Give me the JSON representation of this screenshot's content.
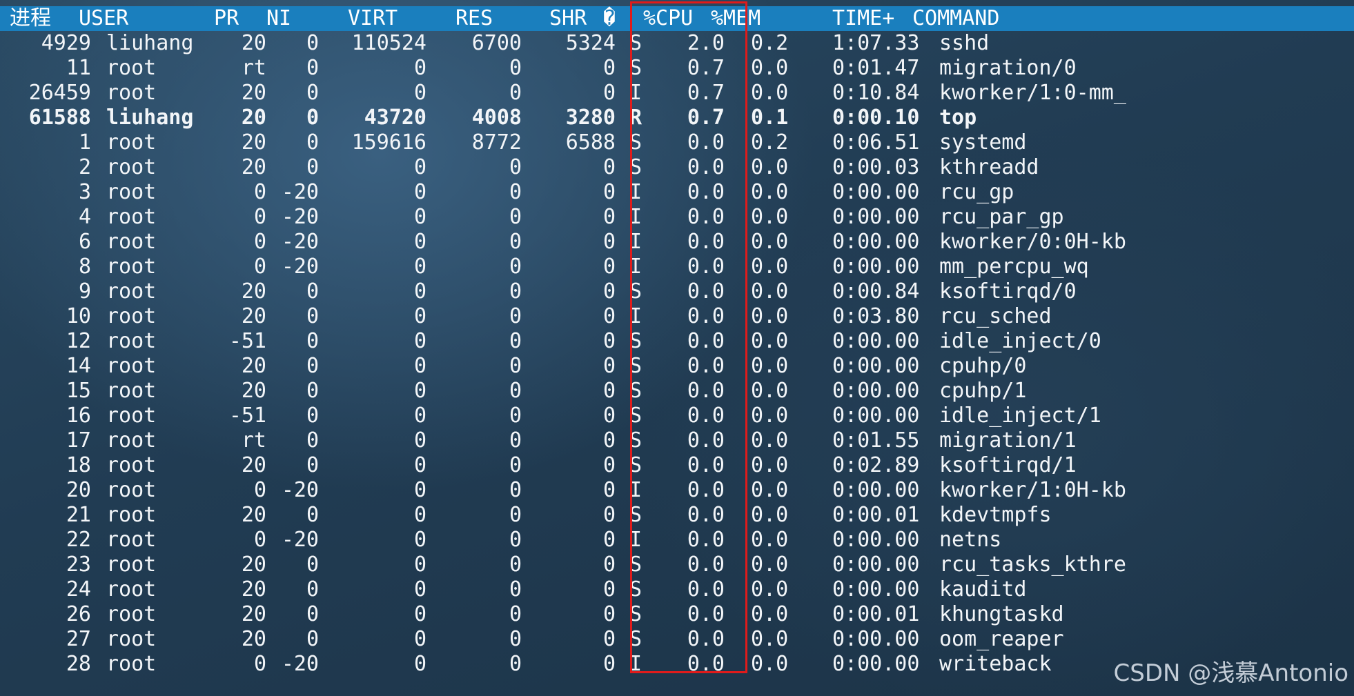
{
  "header": {
    "proc": "进程",
    "user": "USER",
    "pr": "PR",
    "ni": "NI",
    "virt": "VIRT",
    "res": "RES",
    "shr": "SHR",
    "s": "�",
    "cpu": "%CPU",
    "mem": "%MEM",
    "time": "TIME+",
    "command": "COMMAND"
  },
  "processes": [
    {
      "pid": "4929",
      "user": "liuhang",
      "pr": "20",
      "ni": "0",
      "virt": "110524",
      "res": "6700",
      "shr": "5324",
      "s": "S",
      "cpu": "2.0",
      "mem": "0.2",
      "time": "1:07.33",
      "command": "sshd"
    },
    {
      "pid": "11",
      "user": "root",
      "pr": "rt",
      "ni": "0",
      "virt": "0",
      "res": "0",
      "shr": "0",
      "s": "S",
      "cpu": "0.7",
      "mem": "0.0",
      "time": "0:01.47",
      "command": "migration/0"
    },
    {
      "pid": "26459",
      "user": "root",
      "pr": "20",
      "ni": "0",
      "virt": "0",
      "res": "0",
      "shr": "0",
      "s": "I",
      "cpu": "0.7",
      "mem": "0.0",
      "time": "0:10.84",
      "command": "kworker/1:0-mm_"
    },
    {
      "pid": "61588",
      "user": "liuhang",
      "pr": "20",
      "ni": "0",
      "virt": "43720",
      "res": "4008",
      "shr": "3280",
      "s": "R",
      "cpu": "0.7",
      "mem": "0.1",
      "time": "0:00.10",
      "command": "top",
      "bold": true
    },
    {
      "pid": "1",
      "user": "root",
      "pr": "20",
      "ni": "0",
      "virt": "159616",
      "res": "8772",
      "shr": "6588",
      "s": "S",
      "cpu": "0.0",
      "mem": "0.2",
      "time": "0:06.51",
      "command": "systemd"
    },
    {
      "pid": "2",
      "user": "root",
      "pr": "20",
      "ni": "0",
      "virt": "0",
      "res": "0",
      "shr": "0",
      "s": "S",
      "cpu": "0.0",
      "mem": "0.0",
      "time": "0:00.03",
      "command": "kthreadd"
    },
    {
      "pid": "3",
      "user": "root",
      "pr": "0",
      "ni": "-20",
      "virt": "0",
      "res": "0",
      "shr": "0",
      "s": "I",
      "cpu": "0.0",
      "mem": "0.0",
      "time": "0:00.00",
      "command": "rcu_gp"
    },
    {
      "pid": "4",
      "user": "root",
      "pr": "0",
      "ni": "-20",
      "virt": "0",
      "res": "0",
      "shr": "0",
      "s": "I",
      "cpu": "0.0",
      "mem": "0.0",
      "time": "0:00.00",
      "command": "rcu_par_gp"
    },
    {
      "pid": "6",
      "user": "root",
      "pr": "0",
      "ni": "-20",
      "virt": "0",
      "res": "0",
      "shr": "0",
      "s": "I",
      "cpu": "0.0",
      "mem": "0.0",
      "time": "0:00.00",
      "command": "kworker/0:0H-kb"
    },
    {
      "pid": "8",
      "user": "root",
      "pr": "0",
      "ni": "-20",
      "virt": "0",
      "res": "0",
      "shr": "0",
      "s": "I",
      "cpu": "0.0",
      "mem": "0.0",
      "time": "0:00.00",
      "command": "mm_percpu_wq"
    },
    {
      "pid": "9",
      "user": "root",
      "pr": "20",
      "ni": "0",
      "virt": "0",
      "res": "0",
      "shr": "0",
      "s": "S",
      "cpu": "0.0",
      "mem": "0.0",
      "time": "0:00.84",
      "command": "ksoftirqd/0"
    },
    {
      "pid": "10",
      "user": "root",
      "pr": "20",
      "ni": "0",
      "virt": "0",
      "res": "0",
      "shr": "0",
      "s": "I",
      "cpu": "0.0",
      "mem": "0.0",
      "time": "0:03.80",
      "command": "rcu_sched"
    },
    {
      "pid": "12",
      "user": "root",
      "pr": "-51",
      "ni": "0",
      "virt": "0",
      "res": "0",
      "shr": "0",
      "s": "S",
      "cpu": "0.0",
      "mem": "0.0",
      "time": "0:00.00",
      "command": "idle_inject/0"
    },
    {
      "pid": "14",
      "user": "root",
      "pr": "20",
      "ni": "0",
      "virt": "0",
      "res": "0",
      "shr": "0",
      "s": "S",
      "cpu": "0.0",
      "mem": "0.0",
      "time": "0:00.00",
      "command": "cpuhp/0"
    },
    {
      "pid": "15",
      "user": "root",
      "pr": "20",
      "ni": "0",
      "virt": "0",
      "res": "0",
      "shr": "0",
      "s": "S",
      "cpu": "0.0",
      "mem": "0.0",
      "time": "0:00.00",
      "command": "cpuhp/1"
    },
    {
      "pid": "16",
      "user": "root",
      "pr": "-51",
      "ni": "0",
      "virt": "0",
      "res": "0",
      "shr": "0",
      "s": "S",
      "cpu": "0.0",
      "mem": "0.0",
      "time": "0:00.00",
      "command": "idle_inject/1"
    },
    {
      "pid": "17",
      "user": "root",
      "pr": "rt",
      "ni": "0",
      "virt": "0",
      "res": "0",
      "shr": "0",
      "s": "S",
      "cpu": "0.0",
      "mem": "0.0",
      "time": "0:01.55",
      "command": "migration/1"
    },
    {
      "pid": "18",
      "user": "root",
      "pr": "20",
      "ni": "0",
      "virt": "0",
      "res": "0",
      "shr": "0",
      "s": "S",
      "cpu": "0.0",
      "mem": "0.0",
      "time": "0:02.89",
      "command": "ksoftirqd/1"
    },
    {
      "pid": "20",
      "user": "root",
      "pr": "0",
      "ni": "-20",
      "virt": "0",
      "res": "0",
      "shr": "0",
      "s": "I",
      "cpu": "0.0",
      "mem": "0.0",
      "time": "0:00.00",
      "command": "kworker/1:0H-kb"
    },
    {
      "pid": "21",
      "user": "root",
      "pr": "20",
      "ni": "0",
      "virt": "0",
      "res": "0",
      "shr": "0",
      "s": "S",
      "cpu": "0.0",
      "mem": "0.0",
      "time": "0:00.01",
      "command": "kdevtmpfs"
    },
    {
      "pid": "22",
      "user": "root",
      "pr": "0",
      "ni": "-20",
      "virt": "0",
      "res": "0",
      "shr": "0",
      "s": "I",
      "cpu": "0.0",
      "mem": "0.0",
      "time": "0:00.00",
      "command": "netns"
    },
    {
      "pid": "23",
      "user": "root",
      "pr": "20",
      "ni": "0",
      "virt": "0",
      "res": "0",
      "shr": "0",
      "s": "S",
      "cpu": "0.0",
      "mem": "0.0",
      "time": "0:00.00",
      "command": "rcu_tasks_kthre"
    },
    {
      "pid": "24",
      "user": "root",
      "pr": "20",
      "ni": "0",
      "virt": "0",
      "res": "0",
      "shr": "0",
      "s": "S",
      "cpu": "0.0",
      "mem": "0.0",
      "time": "0:00.00",
      "command": "kauditd"
    },
    {
      "pid": "26",
      "user": "root",
      "pr": "20",
      "ni": "0",
      "virt": "0",
      "res": "0",
      "shr": "0",
      "s": "S",
      "cpu": "0.0",
      "mem": "0.0",
      "time": "0:00.01",
      "command": "khungtaskd"
    },
    {
      "pid": "27",
      "user": "root",
      "pr": "20",
      "ni": "0",
      "virt": "0",
      "res": "0",
      "shr": "0",
      "s": "S",
      "cpu": "0.0",
      "mem": "0.0",
      "time": "0:00.00",
      "command": "oom_reaper"
    },
    {
      "pid": "28",
      "user": "root",
      "pr": "0",
      "ni": "-20",
      "virt": "0",
      "res": "0",
      "shr": "0",
      "s": "I",
      "cpu": "0.0",
      "mem": "0.0",
      "time": "0:00.00",
      "command": "writeback"
    }
  ],
  "watermark": "CSDN @浅慕Antonio",
  "colors": {
    "header_bar": "#1a7fbe",
    "highlight_box": "#e01b1b",
    "text": "#f2f5f8"
  }
}
